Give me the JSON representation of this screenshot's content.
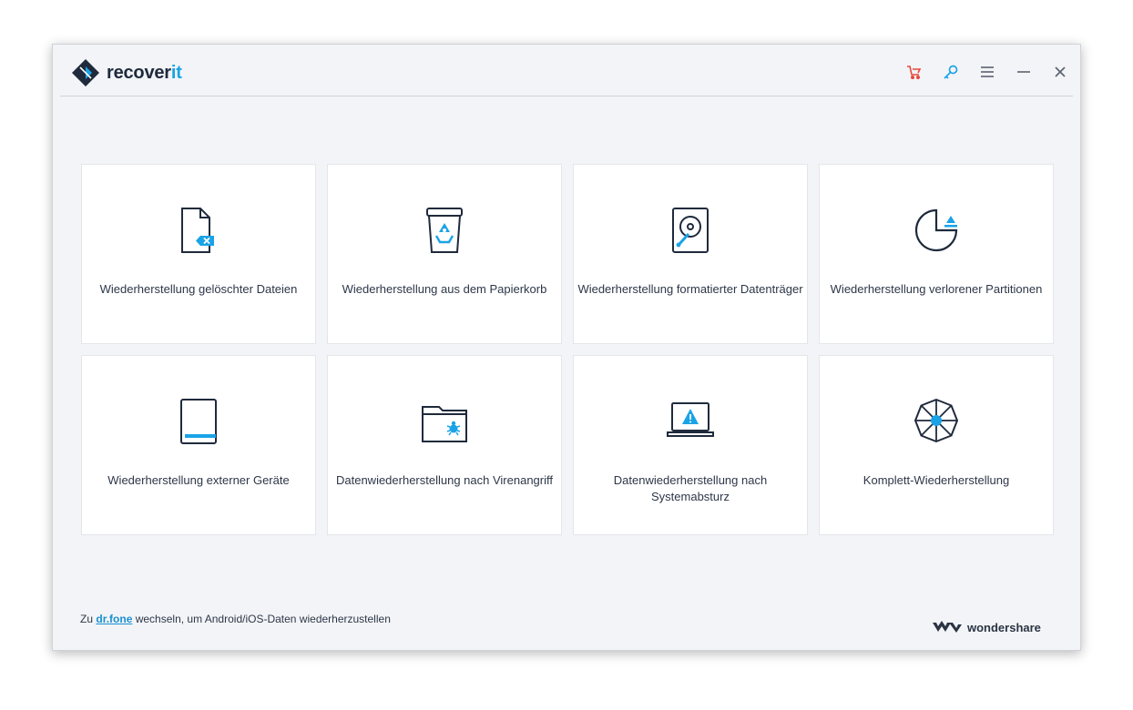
{
  "app": {
    "brand_main": "recover",
    "brand_accent": "it",
    "accent_color": "#1aa3e6",
    "dark_color": "#1f2a3c",
    "cart_color": "#e8483b"
  },
  "toolbar": {
    "cart_icon": "cart-icon",
    "key_icon": "key-icon",
    "menu_icon": "menu-icon",
    "minimize_icon": "minimize-icon",
    "close_icon": "close-icon"
  },
  "cards": [
    {
      "icon": "deleted-file-icon",
      "label": "Wiederherstellung gelöschter Dateien"
    },
    {
      "icon": "recycle-bin-icon",
      "label": "Wiederherstellung aus dem Papierkorb"
    },
    {
      "icon": "hard-drive-icon",
      "label": "Wiederherstellung formatierter Datenträger"
    },
    {
      "icon": "partition-icon",
      "label": "Wiederherstellung verlorener Partitionen"
    },
    {
      "icon": "external-device-icon",
      "label": "Wiederherstellung externer Geräte"
    },
    {
      "icon": "virus-folder-icon",
      "label": "Datenwiederherstellung nach Virenangriff"
    },
    {
      "icon": "system-crash-icon",
      "label": "Datenwiederherstellung nach Systemabsturz"
    },
    {
      "icon": "all-around-icon",
      "label": "Komplett-Wiederherstellung"
    }
  ],
  "footer": {
    "prefix": "Zu",
    "link": "dr.fone",
    "suffix": "wechseln, um Android/iOS-Daten wiederherzustellen",
    "brand": "wondershare"
  }
}
